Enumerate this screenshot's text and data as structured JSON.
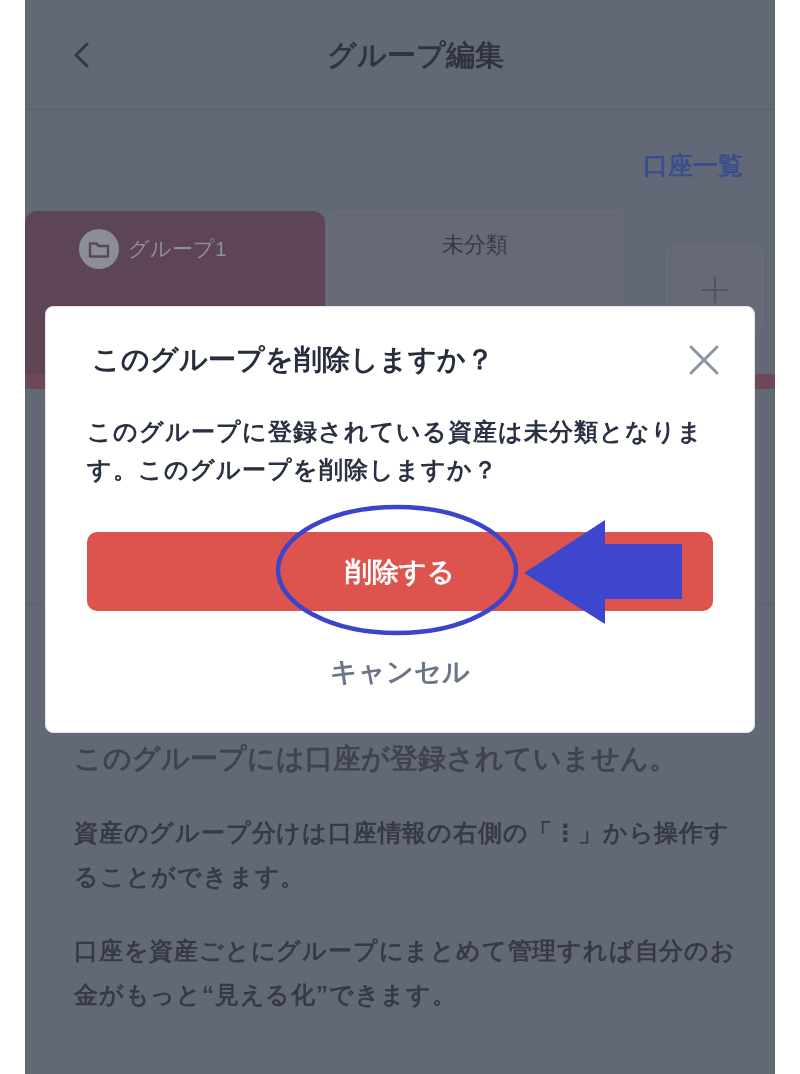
{
  "header": {
    "title": "グループ編集"
  },
  "account_list_link": {
    "label": "口座一覧"
  },
  "group_tabs": [
    {
      "kind": "group",
      "label": "グループ1",
      "selected": true
    },
    {
      "kind": "plain",
      "label": "未分類",
      "selected": false
    },
    {
      "kind": "add",
      "selected": false
    }
  ],
  "empty_state": {
    "title": "このグループには口座が登録されていません。",
    "paragraphs": [
      "資産のグループ分けは口座情報の右側の「⋮」から操作することができます。",
      "口座を資産ごとにグループにまとめて管理すれば自分のお金がもっと“見える化”できます。"
    ]
  },
  "dialog": {
    "title": "このグループを削除しますか？",
    "message": "このグループに登録されている資産は未分類となります。このグループを削除しますか？",
    "confirm_button": "削除する",
    "cancel_button": "キャンセル"
  }
}
